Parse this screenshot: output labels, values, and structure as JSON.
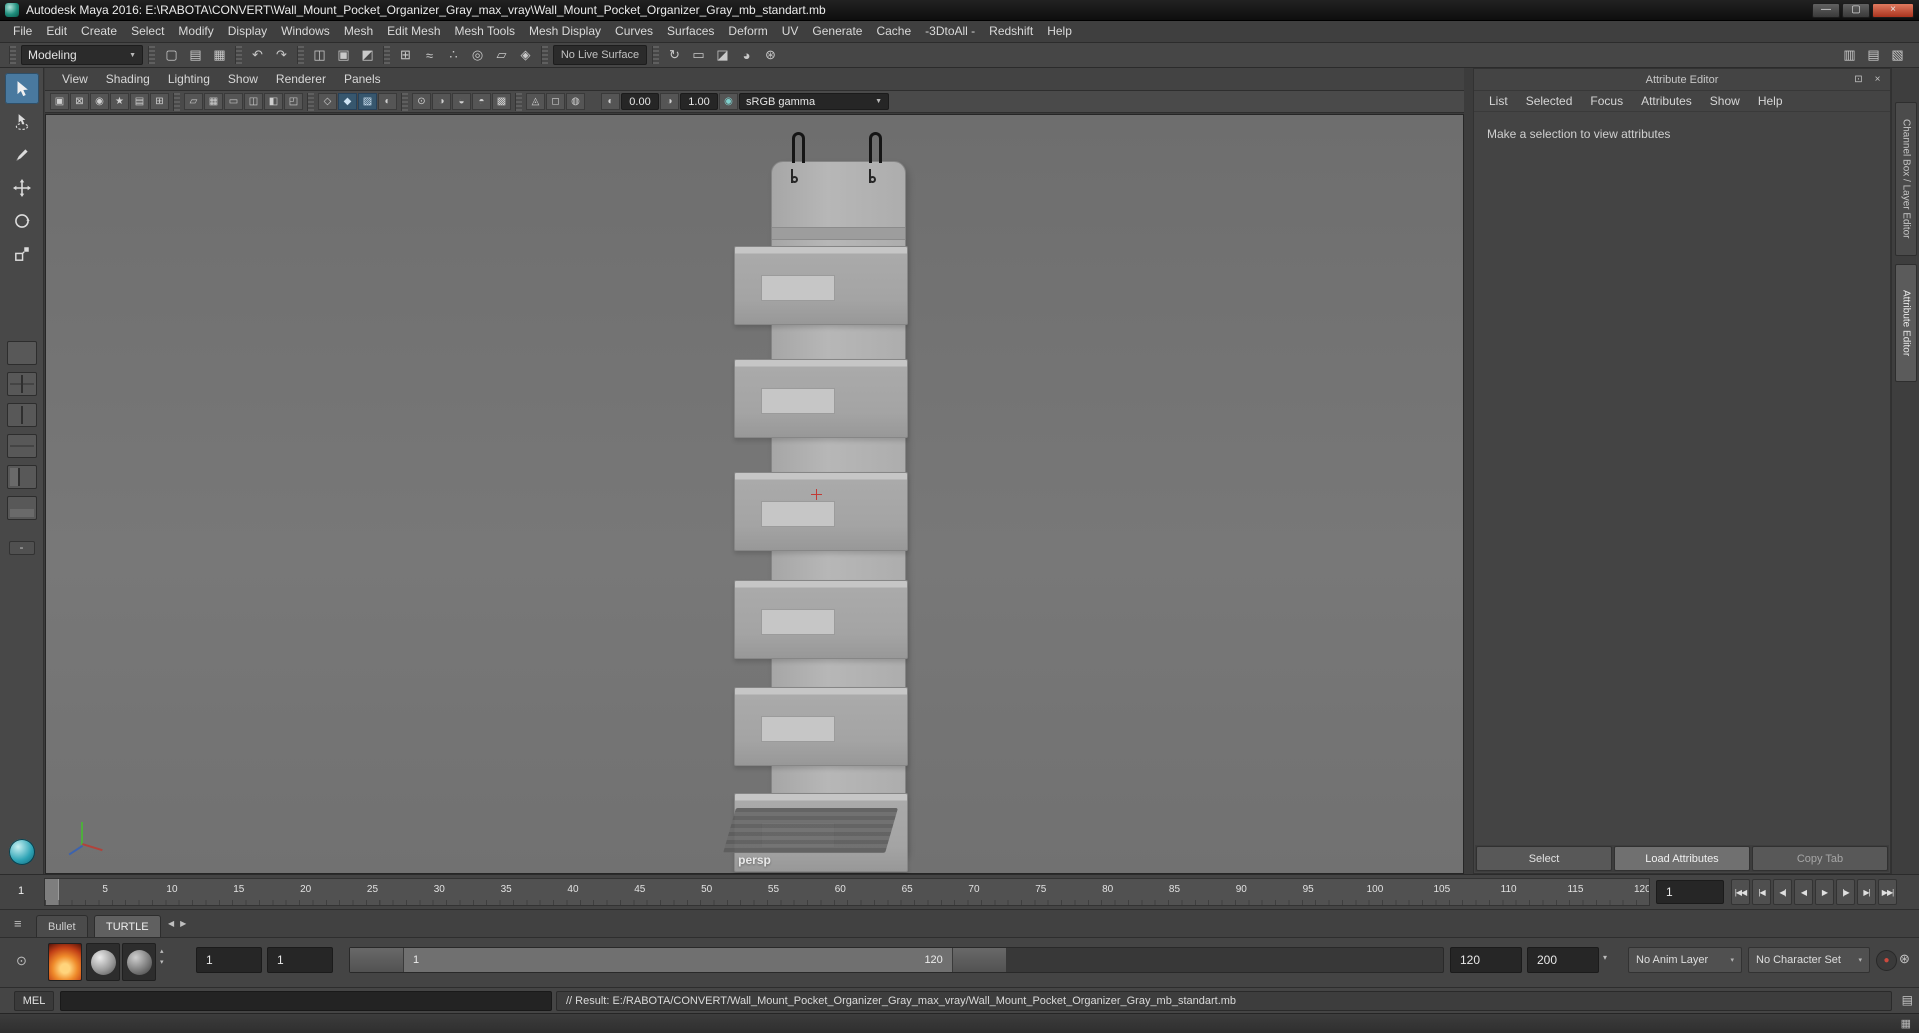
{
  "window": {
    "title": "Autodesk Maya 2016: E:\\RABOTA\\CONVERT\\Wall_Mount_Pocket_Organizer_Gray_max_vray\\Wall_Mount_Pocket_Organizer_Gray_mb_standart.mb",
    "buttons": {
      "minimize": "—",
      "maximize": "▢",
      "close": "×"
    }
  },
  "menu_bar": {
    "items": [
      "File",
      "Edit",
      "Create",
      "Select",
      "Modify",
      "Display",
      "Windows",
      "Mesh",
      "Edit Mesh",
      "Mesh Tools",
      "Mesh Display",
      "Curves",
      "Surfaces",
      "Deform",
      "UV",
      "Generate",
      "Cache",
      "-3DtoAll -",
      "Redshift",
      "Help"
    ]
  },
  "status_line": {
    "workspace": "Modeling",
    "live_surface": "No Live Surface",
    "left_icons": [
      {
        "name": "new-scene-icon",
        "glyph": "▢"
      },
      {
        "name": "open-scene-icon",
        "glyph": "▤"
      },
      {
        "name": "save-scene-icon",
        "glyph": "▦"
      },
      {
        "sep": true
      },
      {
        "name": "undo-icon",
        "glyph": "↶"
      },
      {
        "name": "redo-icon",
        "glyph": "↷"
      },
      {
        "sep": true
      },
      {
        "name": "select-by-hierarchy-icon",
        "glyph": "◫"
      },
      {
        "name": "select-by-object-icon",
        "glyph": "▣"
      },
      {
        "name": "select-by-component-icon",
        "glyph": "◩"
      },
      {
        "sep": true
      },
      {
        "name": "snap-to-grid-icon",
        "glyph": "⊞"
      },
      {
        "name": "snap-to-curve-icon",
        "glyph": "≈"
      },
      {
        "name": "snap-to-point-icon",
        "glyph": "∴"
      },
      {
        "name": "snap-to-projected-center-icon",
        "glyph": "◎"
      },
      {
        "name": "snap-to-view-plane-icon",
        "glyph": "▱"
      },
      {
        "name": "make-live-icon",
        "glyph": "◈"
      },
      {
        "sep": true
      }
    ],
    "right_of_field_icons": [
      {
        "sep": true
      },
      {
        "name": "construction-history-icon",
        "glyph": "↻"
      },
      {
        "name": "open-render-view-icon",
        "glyph": "▭"
      },
      {
        "name": "render-current-frame-icon",
        "glyph": "◪"
      },
      {
        "name": "ipr-render-icon",
        "glyph": "◕"
      },
      {
        "name": "render-settings-icon",
        "glyph": "⊛"
      }
    ],
    "right_icons": [
      {
        "name": "show-attribute-editor-icon",
        "glyph": "▥"
      },
      {
        "name": "show-tool-settings-icon",
        "glyph": "▤"
      },
      {
        "name": "show-channel-box-icon",
        "glyph": "▧"
      }
    ]
  },
  "panel_menu": {
    "items": [
      "View",
      "Shading",
      "Lighting",
      "Show",
      "Renderer",
      "Panels"
    ]
  },
  "panel_toolbar": {
    "icons": [
      {
        "name": "select-camera-icon",
        "glyph": "▣"
      },
      {
        "name": "lock-camera-icon",
        "glyph": "⊠"
      },
      {
        "name": "camera-attributes-icon",
        "glyph": "◉"
      },
      {
        "name": "bookmarks-icon",
        "glyph": "★"
      },
      {
        "name": "image-plane-icon",
        "glyph": "▤"
      },
      {
        "name": "two-d-pan-zoom-icon",
        "glyph": "⊞"
      },
      {
        "sep": true
      },
      {
        "name": "grease-pencil-icon",
        "glyph": "▱"
      },
      {
        "name": "grid-toggle-icon",
        "glyph": "▦"
      },
      {
        "name": "film-gate-icon",
        "glyph": "▭"
      },
      {
        "name": "resolution-gate-icon",
        "glyph": "◫"
      },
      {
        "name": "gate-mask-icon",
        "glyph": "◧"
      },
      {
        "name": "field-chart-icon",
        "glyph": "◰"
      },
      {
        "sep": true
      },
      {
        "name": "wireframe-icon",
        "glyph": "◇"
      },
      {
        "name": "shaded-icon",
        "glyph": "◆",
        "active": true
      },
      {
        "name": "textured-icon",
        "glyph": "▨",
        "active": true
      },
      {
        "name": "use-default-material-icon",
        "glyph": "◐"
      },
      {
        "sep": true
      },
      {
        "name": "lighting-icon",
        "glyph": "⊙"
      },
      {
        "name": "shadows-icon",
        "glyph": "◑"
      },
      {
        "name": "screen-space-ao-icon",
        "glyph": "◒"
      },
      {
        "name": "motion-blur-icon",
        "glyph": "◓"
      },
      {
        "name": "multisampling-icon",
        "glyph": "▩"
      },
      {
        "sep": true
      },
      {
        "name": "isolate-select-icon",
        "glyph": "◬"
      },
      {
        "name": "xray-icon",
        "glyph": "◻"
      },
      {
        "name": "plugin-shading-icon",
        "glyph": "◍"
      }
    ],
    "exposure_value": "0.00",
    "gamma_value": "1.00",
    "view_transform": "sRGB gamma"
  },
  "viewport": {
    "camera_label": "persp"
  },
  "attribute_editor": {
    "title": "Attribute Editor",
    "menus": [
      "List",
      "Selected",
      "Focus",
      "Attributes",
      "Show",
      "Help"
    ],
    "message": "Make a selection to view attributes",
    "select_button": "Select",
    "load_attributes_button": "Load Attributes",
    "copy_tab_button": "Copy Tab"
  },
  "side_tabs": {
    "channel_box": "Channel Box / Layer Editor",
    "attribute_editor": "Attribute Editor"
  },
  "timeline": {
    "ticks": [
      "5",
      "10",
      "15",
      "20",
      "25",
      "30",
      "35",
      "40",
      "45",
      "50",
      "55",
      "60",
      "65",
      "70",
      "75",
      "80",
      "85",
      "90",
      "95",
      "100",
      "105",
      "110",
      "115",
      "120"
    ],
    "current_frame": "1",
    "current_time": "1",
    "playback": [
      {
        "name": "go-to-start-button",
        "glyph": "|◀◀"
      },
      {
        "name": "step-back-key-button",
        "glyph": "|◀"
      },
      {
        "name": "step-back-frame-button",
        "glyph": "◀|"
      },
      {
        "name": "play-backwards-button",
        "glyph": "◀"
      },
      {
        "name": "play-forwards-button",
        "glyph": "▶"
      },
      {
        "name": "step-forward-frame-button",
        "glyph": "|▶"
      },
      {
        "name": "step-forward-key-button",
        "glyph": "▶|"
      },
      {
        "name": "go-to-end-button",
        "glyph": "▶▶|"
      }
    ]
  },
  "range_slider": {
    "animation_start": "1",
    "playback_start": "1",
    "range_start_label": "1",
    "range_end_label": "120",
    "playback_end": "120",
    "animation_end": "200",
    "anim_layer": "No Anim Layer",
    "character_set": "No Character Set"
  },
  "bottom_tabs": {
    "items": [
      "Bullet",
      "TURTLE"
    ]
  },
  "command_line": {
    "label": "MEL",
    "input_value": "",
    "result": "// Result: E:/RABOTA/CONVERT/Wall_Mount_Pocket_Organizer_Gray_max_vray/Wall_Mount_Pocket_Organizer_Gray_mb_standart.mb"
  },
  "icons": {
    "dropdown_arrow": "▼",
    "caret": "▾",
    "hamburger": "≡",
    "float_window": "⊡",
    "close_x": "×",
    "prev_arrow": "◀",
    "next_arrow": "▶",
    "spin_up": "▴",
    "spin_down": "▾",
    "autokey_dot": "●",
    "anim_prefs": "⊛",
    "script_editor": "▤",
    "help_grid": "▦",
    "options_circle": "⊙",
    "exposure": "◐",
    "gamma": "◑",
    "color_mgmt": "◉"
  }
}
